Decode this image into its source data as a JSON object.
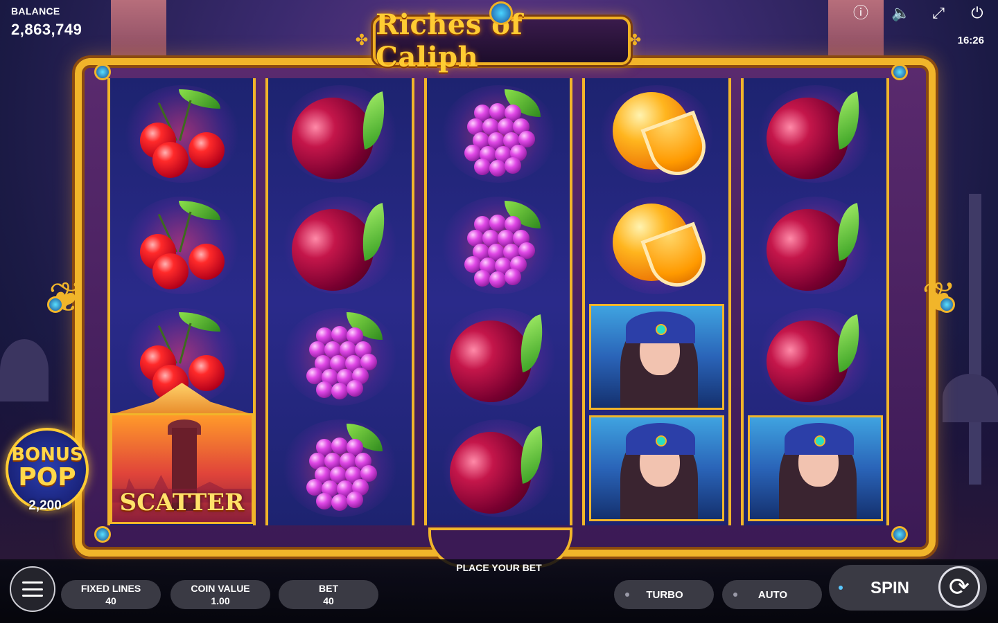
{
  "balance": {
    "label": "BALANCE",
    "value": "2,863,749"
  },
  "game": {
    "title": "Riches of Caliph"
  },
  "clock": "16:26",
  "top_icons": [
    "info-icon",
    "sound-icon",
    "fullscreen-icon",
    "power-icon"
  ],
  "reels": [
    [
      "cherry",
      "cherry",
      "cherry",
      "scatter"
    ],
    [
      "plum",
      "plum",
      "grape",
      "grape"
    ],
    [
      "grape",
      "grape",
      "plum",
      "plum"
    ],
    [
      "orange",
      "orange",
      "lady",
      "lady"
    ],
    [
      "plum",
      "plum",
      "plum",
      "lady"
    ]
  ],
  "scatter": {
    "label": "SCATTER"
  },
  "bonus_pop": {
    "word1": "BONUS",
    "word2": "POP",
    "amount": "2,200"
  },
  "bottom": {
    "message": "PLACE YOUR BET",
    "fixed_lines": {
      "label": "FIXED LINES",
      "value": "40"
    },
    "coin_value": {
      "label": "COIN VALUE",
      "value": "1.00"
    },
    "bet": {
      "label": "BET",
      "value": "40"
    },
    "turbo": "TURBO",
    "auto": "AUTO",
    "spin": "SPIN"
  },
  "colors": {
    "gold": "#f1b52a",
    "reel_blue": "#2a2a8a",
    "panel": "#3a3a44"
  }
}
